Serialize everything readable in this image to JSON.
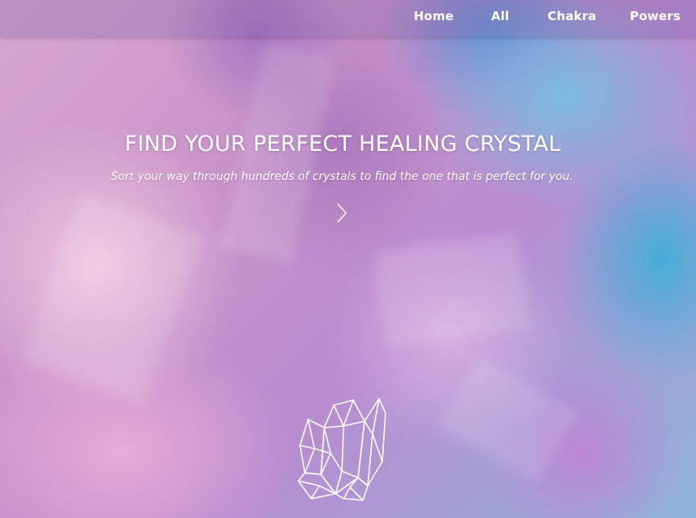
{
  "nav": {
    "items": [
      {
        "label": "Home"
      },
      {
        "label": "All"
      },
      {
        "label": "Chakra"
      },
      {
        "label": "Powers"
      }
    ]
  },
  "hero": {
    "title": "FIND YOUR PERFECT HEALING CRYSTAL",
    "subtitle": "Sort your way through hundreds of crystals to find the one that is perfect for you.",
    "arrow_icon": "chevron-right-icon",
    "logo_icon": "crystal-cluster-icon"
  },
  "colors": {
    "text": "#ffffff",
    "background_pink": "#d8a8cf",
    "background_purple": "#b98cd0",
    "background_blue": "#8fb5db"
  }
}
